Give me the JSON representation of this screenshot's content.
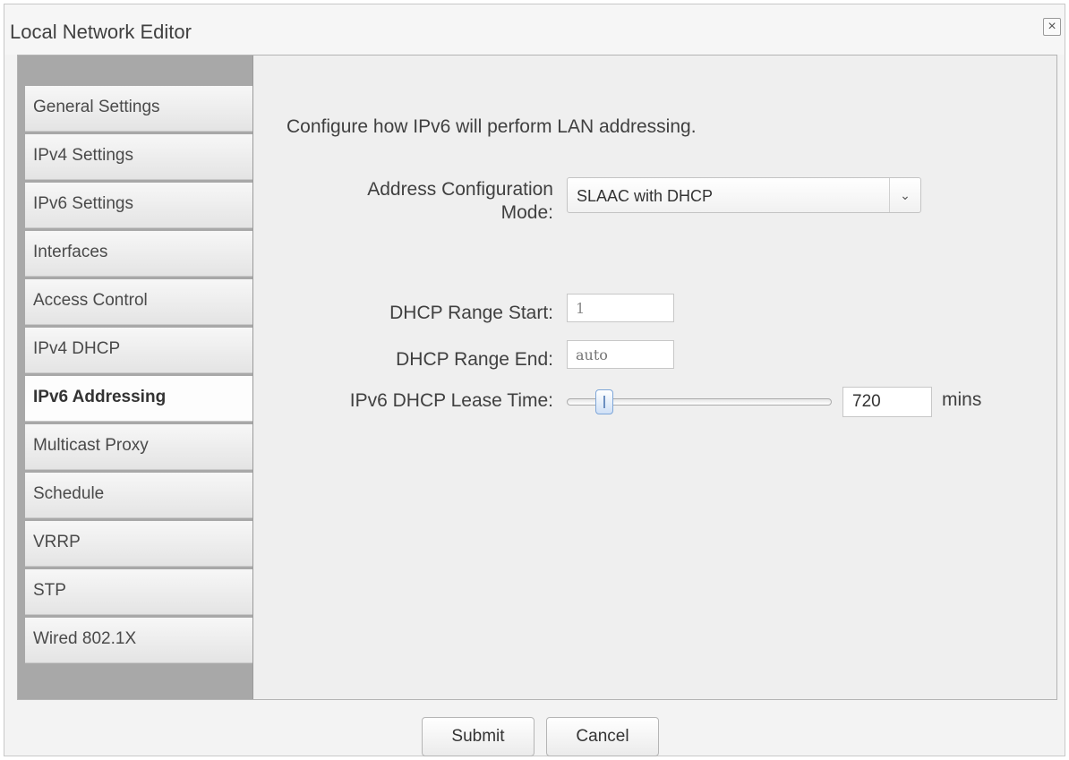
{
  "window": {
    "title": "Local Network Editor",
    "close_symbol": "×"
  },
  "sidebar": {
    "items": [
      {
        "label": "General Settings"
      },
      {
        "label": "IPv4 Settings"
      },
      {
        "label": "IPv6 Settings"
      },
      {
        "label": "Interfaces"
      },
      {
        "label": "Access Control"
      },
      {
        "label": "IPv4 DHCP"
      },
      {
        "label": "IPv6 Addressing",
        "active": true
      },
      {
        "label": "Multicast Proxy"
      },
      {
        "label": "Schedule"
      },
      {
        "label": "VRRP"
      },
      {
        "label": "STP"
      },
      {
        "label": "Wired 802.1X"
      }
    ]
  },
  "content": {
    "intro": "Configure how IPv6 will perform LAN addressing.",
    "address_mode": {
      "label_line1": "Address Configuration",
      "label_line2": "Mode:",
      "value": "SLAAC with DHCP",
      "arrow": "⌄"
    },
    "range_start": {
      "label": "DHCP Range Start:",
      "value": "1"
    },
    "range_end": {
      "label": "DHCP Range End:",
      "value": "",
      "placeholder": "auto"
    },
    "lease_time": {
      "label": "IPv6 DHCP Lease Time:",
      "value": "720",
      "unit": "mins"
    }
  },
  "footer": {
    "submit_label": "Submit",
    "cancel_label": "Cancel"
  },
  "colors": {
    "sidebar_bg": "#a8a8a8",
    "panel_bg": "#efefef",
    "slider_accent": "#7ea6d8"
  }
}
